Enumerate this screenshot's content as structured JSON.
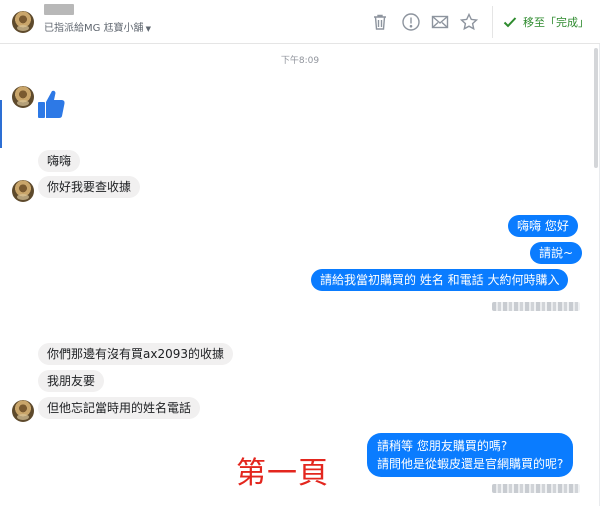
{
  "header": {
    "subtitle": "已指派給MG 尪寶小舖",
    "icons": [
      "trash-icon",
      "info-icon",
      "mail-icon",
      "star-icon"
    ],
    "done_label": "移至「完成」",
    "done_color": "#2e8b2e"
  },
  "timestamp": "下午8:09",
  "messages": {
    "m1": "嗨嗨",
    "m2": "你好我要查收據",
    "m3": "嗨嗨 您好",
    "m4": "請說~",
    "m5": "請給我當初購買的 姓名 和電話  大約何時購入",
    "m6": "你們那邊有沒有買ax2093的收據",
    "m7": "我朋友要",
    "m8": "但他忘記當時用的姓名電話",
    "m9_line1": "請稍等  您朋友購買的嗎?",
    "m9_line2": "請問他是從蝦皮還是官網購買的呢?"
  },
  "overlay": "第一頁",
  "colors": {
    "outgoing": "#0a7cff",
    "incoming": "#f1f0f0",
    "overlay": "#e3261e"
  }
}
